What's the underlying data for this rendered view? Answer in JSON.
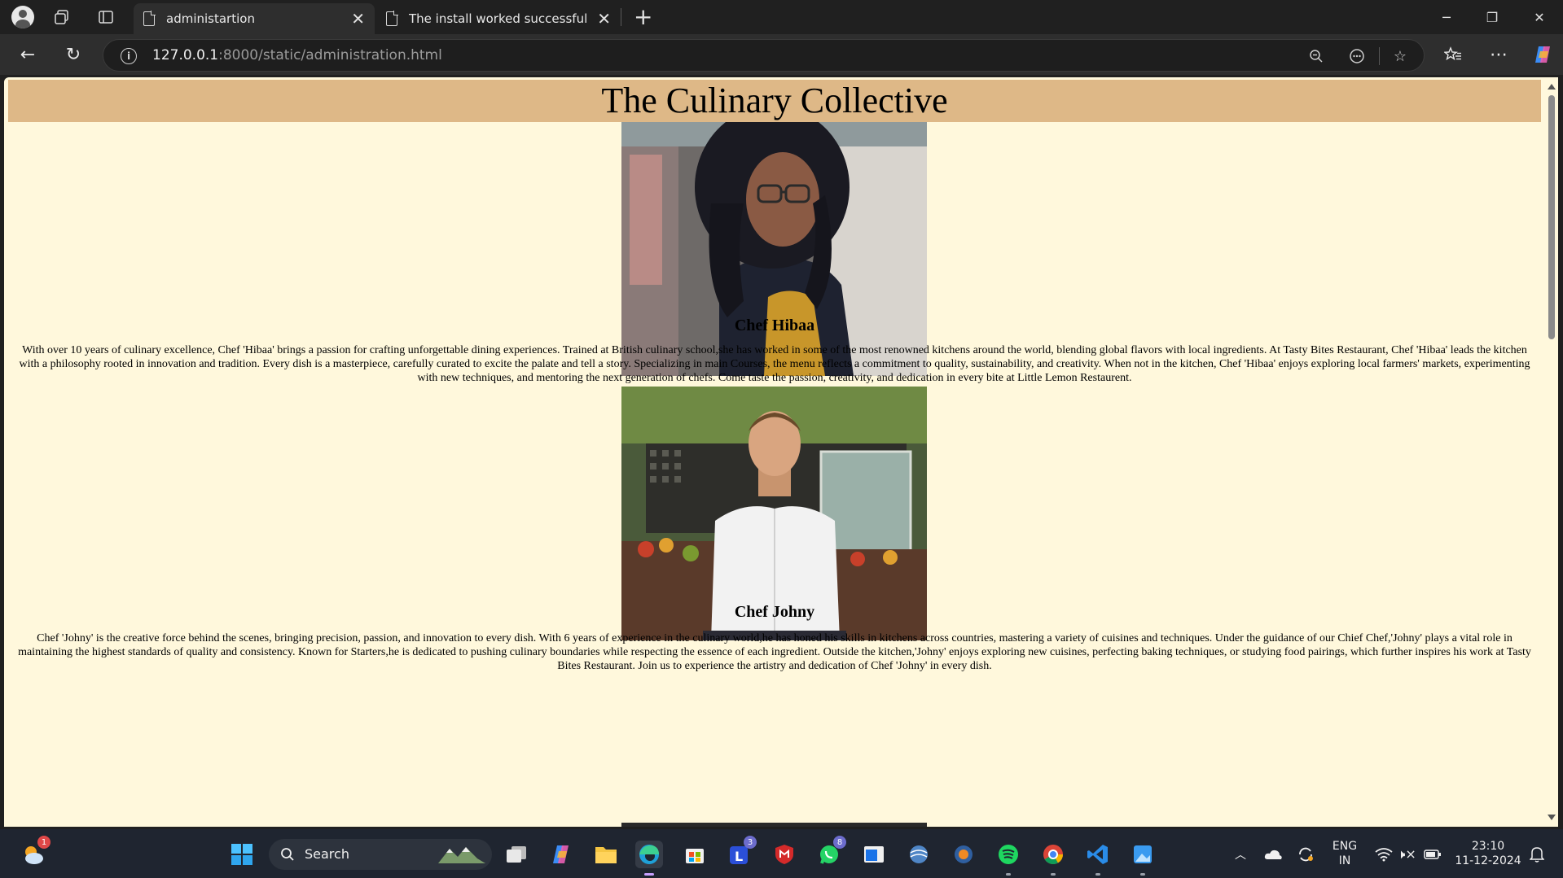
{
  "browser": {
    "tabs": [
      {
        "title": "administartion",
        "active": true
      },
      {
        "title": "The install worked successfully! Co",
        "active": false
      }
    ],
    "url_host": "127.0.0.1",
    "url_rest": ":8000/static/administration.html"
  },
  "page": {
    "header_title": "The Culinary Collective",
    "header_bg": "#deb887",
    "page_bg": "#fff8dc",
    "chefs": [
      {
        "name": "Chef Hibaa",
        "photo": "woman-with-glasses-portrait",
        "bio": "With over 10 years of culinary excellence, Chef 'Hibaa' brings a passion for crafting unforgettable dining experiences. Trained at British culinary school,she has worked in some of the most renowned kitchens around the world, blending global flavors with local ingredients. At Tasty Bites Restaurant, Chef 'Hibaa' leads the kitchen with a philosophy rooted in innovation and tradition. Every dish is a masterpiece, carefully curated to excite the palate and tell a story. Specializing in main Courses, the menu reflects a commitment to quality, sustainability, and creativity. When not in the kitchen, Chef 'Hibaa' enjoys exploring local farmers' markets, experimenting with new techniques, and mentoring the next generation of chefs. Come taste the passion, creativity, and dedication in every bite at Little Lemon Restaurent."
      },
      {
        "name": "Chef Johny",
        "photo": "chef-in-white-coat-portrait",
        "bio": "Chef 'Johny' is the creative force behind the scenes, bringing precision, passion, and innovation to every dish. With 6 years of experience in the culinary world,he has honed his skills in kitchens across countries, mastering a variety of cuisines and techniques. Under the guidance of our Chief Chef,'Johny' plays a vital role in maintaining the highest standards of quality and consistency. Known for Starters,he is dedicated to pushing culinary boundaries while respecting the essence of each ingredient. Outside the kitchen,'Johny' enjoys exploring new cuisines, perfecting baking techniques, or studying food pairings, which further inspires his work at Tasty Bites Restaurant. Join us to experience the artistry and dedication of Chef 'Johny' in every dish."
      }
    ]
  },
  "taskbar": {
    "search_label": "Search",
    "weather_badge": "1",
    "teams_badge": "3",
    "whatsapp_badge": "8",
    "lang_line1": "ENG",
    "lang_line2": "IN",
    "time": "23:10",
    "date": "11-12-2024"
  }
}
